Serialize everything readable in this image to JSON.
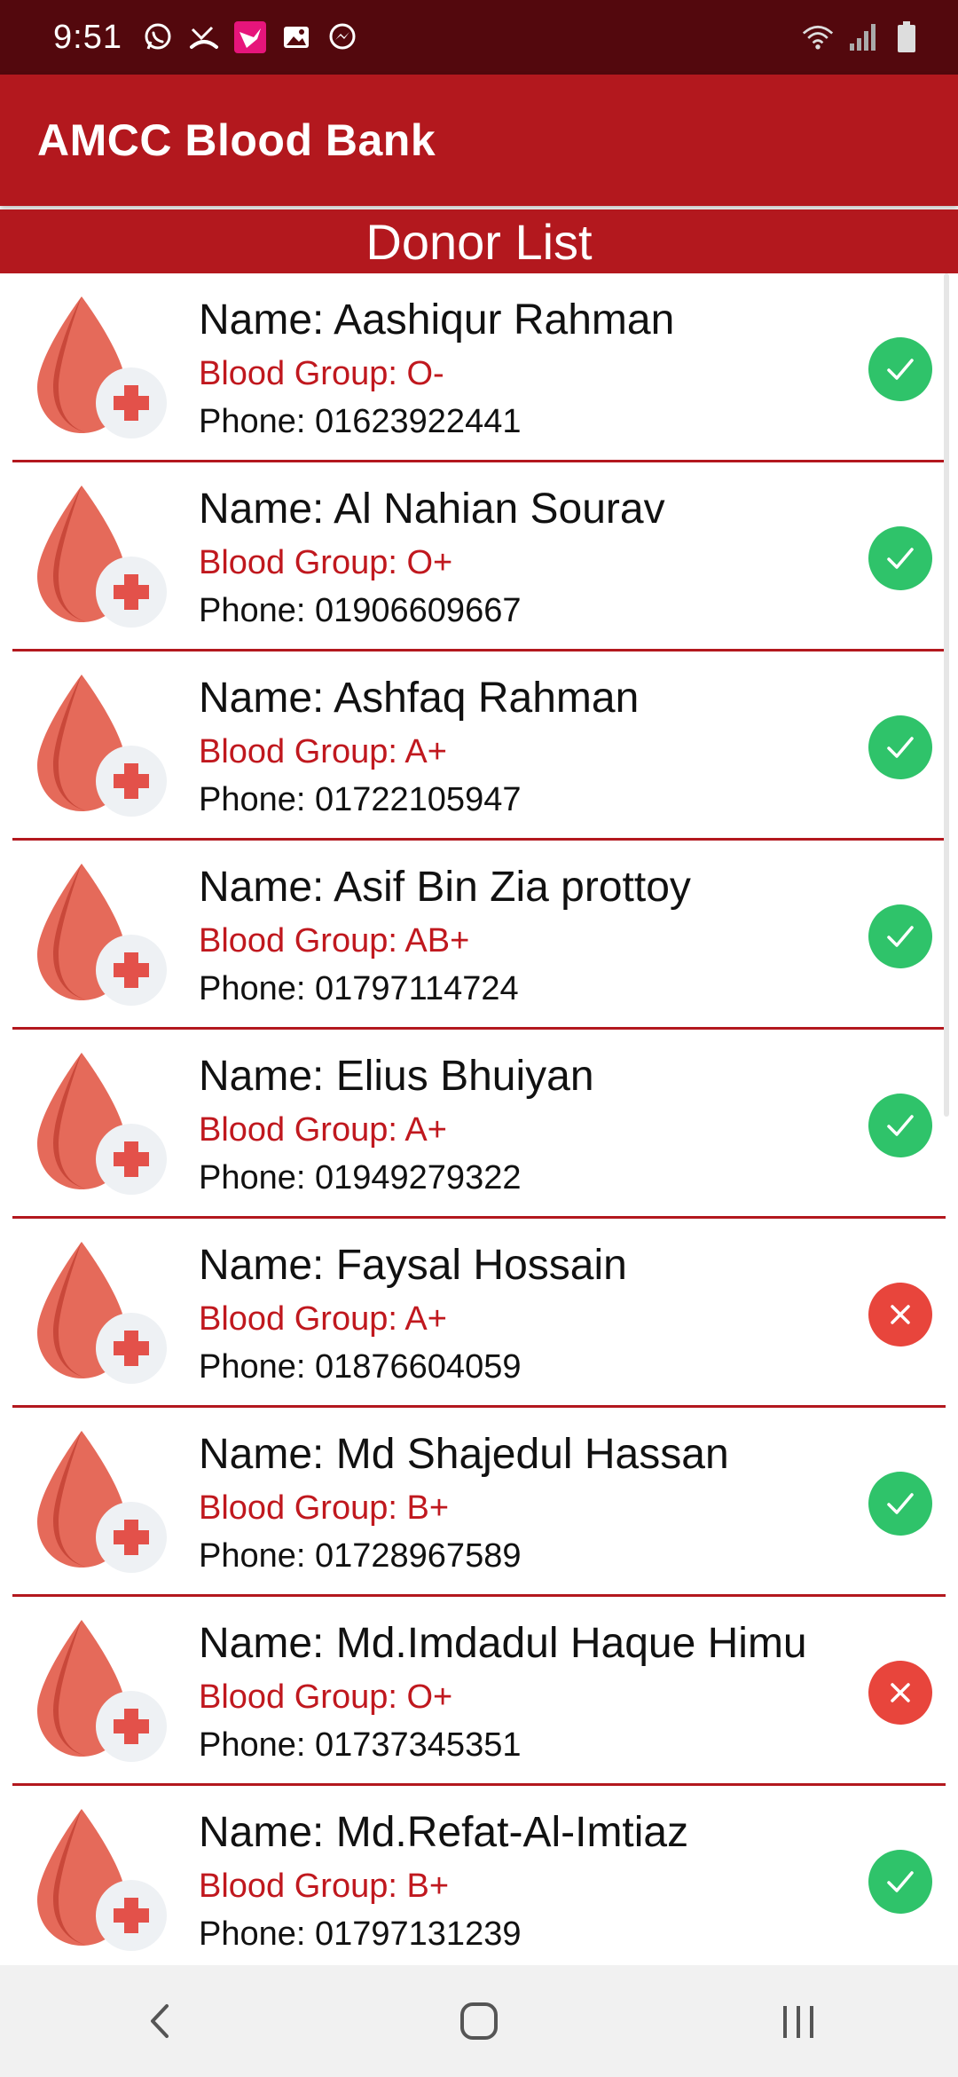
{
  "status_bar": {
    "time": "9:51",
    "left_icons": [
      "whatsapp-icon",
      "missed-call-icon",
      "hummingbird-app-icon",
      "gallery-icon",
      "messenger-icon"
    ],
    "right_icons": [
      "wifi-icon",
      "signal-icon",
      "battery-icon"
    ]
  },
  "app_bar": {
    "title": "AMCC Blood Bank"
  },
  "header": {
    "title": "Donor List"
  },
  "colors": {
    "primary": "#b3181e",
    "status_bar": "#53080d",
    "available": "#2fc36a",
    "unavailable": "#e8453c",
    "drop": "#e06050"
  },
  "donors": [
    {
      "name": "Name: Aashiqur Rahman",
      "blood": "Blood Group: O-",
      "phone": "Phone: 01623922441",
      "status": "available",
      "status_icon": "check-icon"
    },
    {
      "name": "Name: Al Nahian Sourav",
      "blood": "Blood Group: O+",
      "phone": "Phone: 01906609667",
      "status": "available",
      "status_icon": "check-icon"
    },
    {
      "name": "Name: Ashfaq Rahman",
      "blood": "Blood Group: A+",
      "phone": "Phone: 01722105947",
      "status": "available",
      "status_icon": "check-icon"
    },
    {
      "name": "Name: Asif Bin Zia prottoy",
      "blood": "Blood Group: AB+",
      "phone": "Phone: 01797114724",
      "status": "available",
      "status_icon": "check-icon"
    },
    {
      "name": "Name: Elius Bhuiyan",
      "blood": "Blood Group: A+",
      "phone": "Phone: 01949279322",
      "status": "available",
      "status_icon": "check-icon"
    },
    {
      "name": "Name: Faysal Hossain",
      "blood": "Blood Group: A+",
      "phone": "Phone: 01876604059",
      "status": "unavailable",
      "status_icon": "x-icon"
    },
    {
      "name": "Name: Md Shajedul Hassan",
      "blood": "Blood Group: B+",
      "phone": "Phone: 01728967589",
      "status": "available",
      "status_icon": "check-icon"
    },
    {
      "name": "Name: Md.Imdadul Haque Himu",
      "blood": "Blood Group: O+",
      "phone": "Phone: 01737345351",
      "status": "unavailable",
      "status_icon": "x-icon"
    },
    {
      "name": "Name: Md.Refat-Al-Imtiaz",
      "blood": "Blood Group: B+",
      "phone": "Phone: 01797131239",
      "status": "available",
      "status_icon": "check-icon"
    }
  ],
  "nav_bar": {
    "buttons": [
      "back-icon",
      "home-icon",
      "recents-icon"
    ]
  }
}
